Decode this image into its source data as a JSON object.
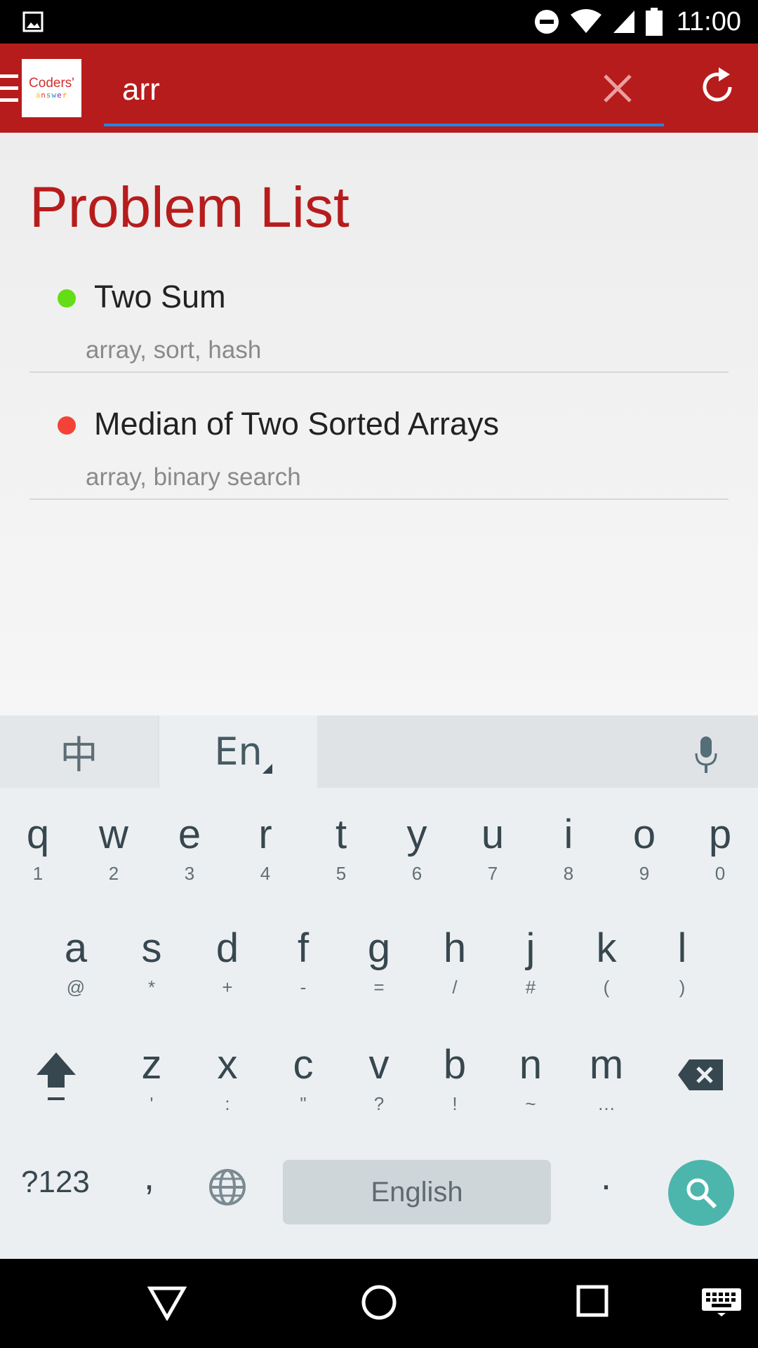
{
  "status_bar": {
    "time": "11:00",
    "icons": [
      "image-icon",
      "do-not-disturb-icon",
      "wifi-icon",
      "cell-signal-icon",
      "battery-icon"
    ]
  },
  "app_bar": {
    "logo_top": "Coders'",
    "logo_bottom": "answer",
    "search_value": "arr",
    "accent_color": "#b71c1c",
    "underline_color": "#1e88e5"
  },
  "content": {
    "title": "Problem List",
    "problems": [
      {
        "name": "Two Sum",
        "tags": "array, sort, hash",
        "status_color": "#64dd17"
      },
      {
        "name": "Median of Two Sorted Arrays",
        "tags": "array, binary search",
        "status_color": "#f44336"
      }
    ]
  },
  "keyboard": {
    "lang_zh": "中",
    "lang_en": "En",
    "row1": [
      {
        "k": "q",
        "s": "1"
      },
      {
        "k": "w",
        "s": "2"
      },
      {
        "k": "e",
        "s": "3"
      },
      {
        "k": "r",
        "s": "4"
      },
      {
        "k": "t",
        "s": "5"
      },
      {
        "k": "y",
        "s": "6"
      },
      {
        "k": "u",
        "s": "7"
      },
      {
        "k": "i",
        "s": "8"
      },
      {
        "k": "o",
        "s": "9"
      },
      {
        "k": "p",
        "s": "0"
      }
    ],
    "row2": [
      {
        "k": "a",
        "s": "@"
      },
      {
        "k": "s",
        "s": "*"
      },
      {
        "k": "d",
        "s": "+"
      },
      {
        "k": "f",
        "s": "-"
      },
      {
        "k": "g",
        "s": "="
      },
      {
        "k": "h",
        "s": "/"
      },
      {
        "k": "j",
        "s": "#"
      },
      {
        "k": "k",
        "s": "("
      },
      {
        "k": "l",
        "s": ")"
      }
    ],
    "row3": [
      {
        "k": "z",
        "s": "'"
      },
      {
        "k": "x",
        "s": ":"
      },
      {
        "k": "c",
        "s": "\""
      },
      {
        "k": "v",
        "s": "?"
      },
      {
        "k": "b",
        "s": "!"
      },
      {
        "k": "n",
        "s": "~"
      },
      {
        "k": "m",
        "s": "…"
      }
    ],
    "symbols_label": "?123",
    "comma_label": ",",
    "space_label": "English",
    "period_label": ".",
    "search_key_color": "#4db6ac"
  }
}
